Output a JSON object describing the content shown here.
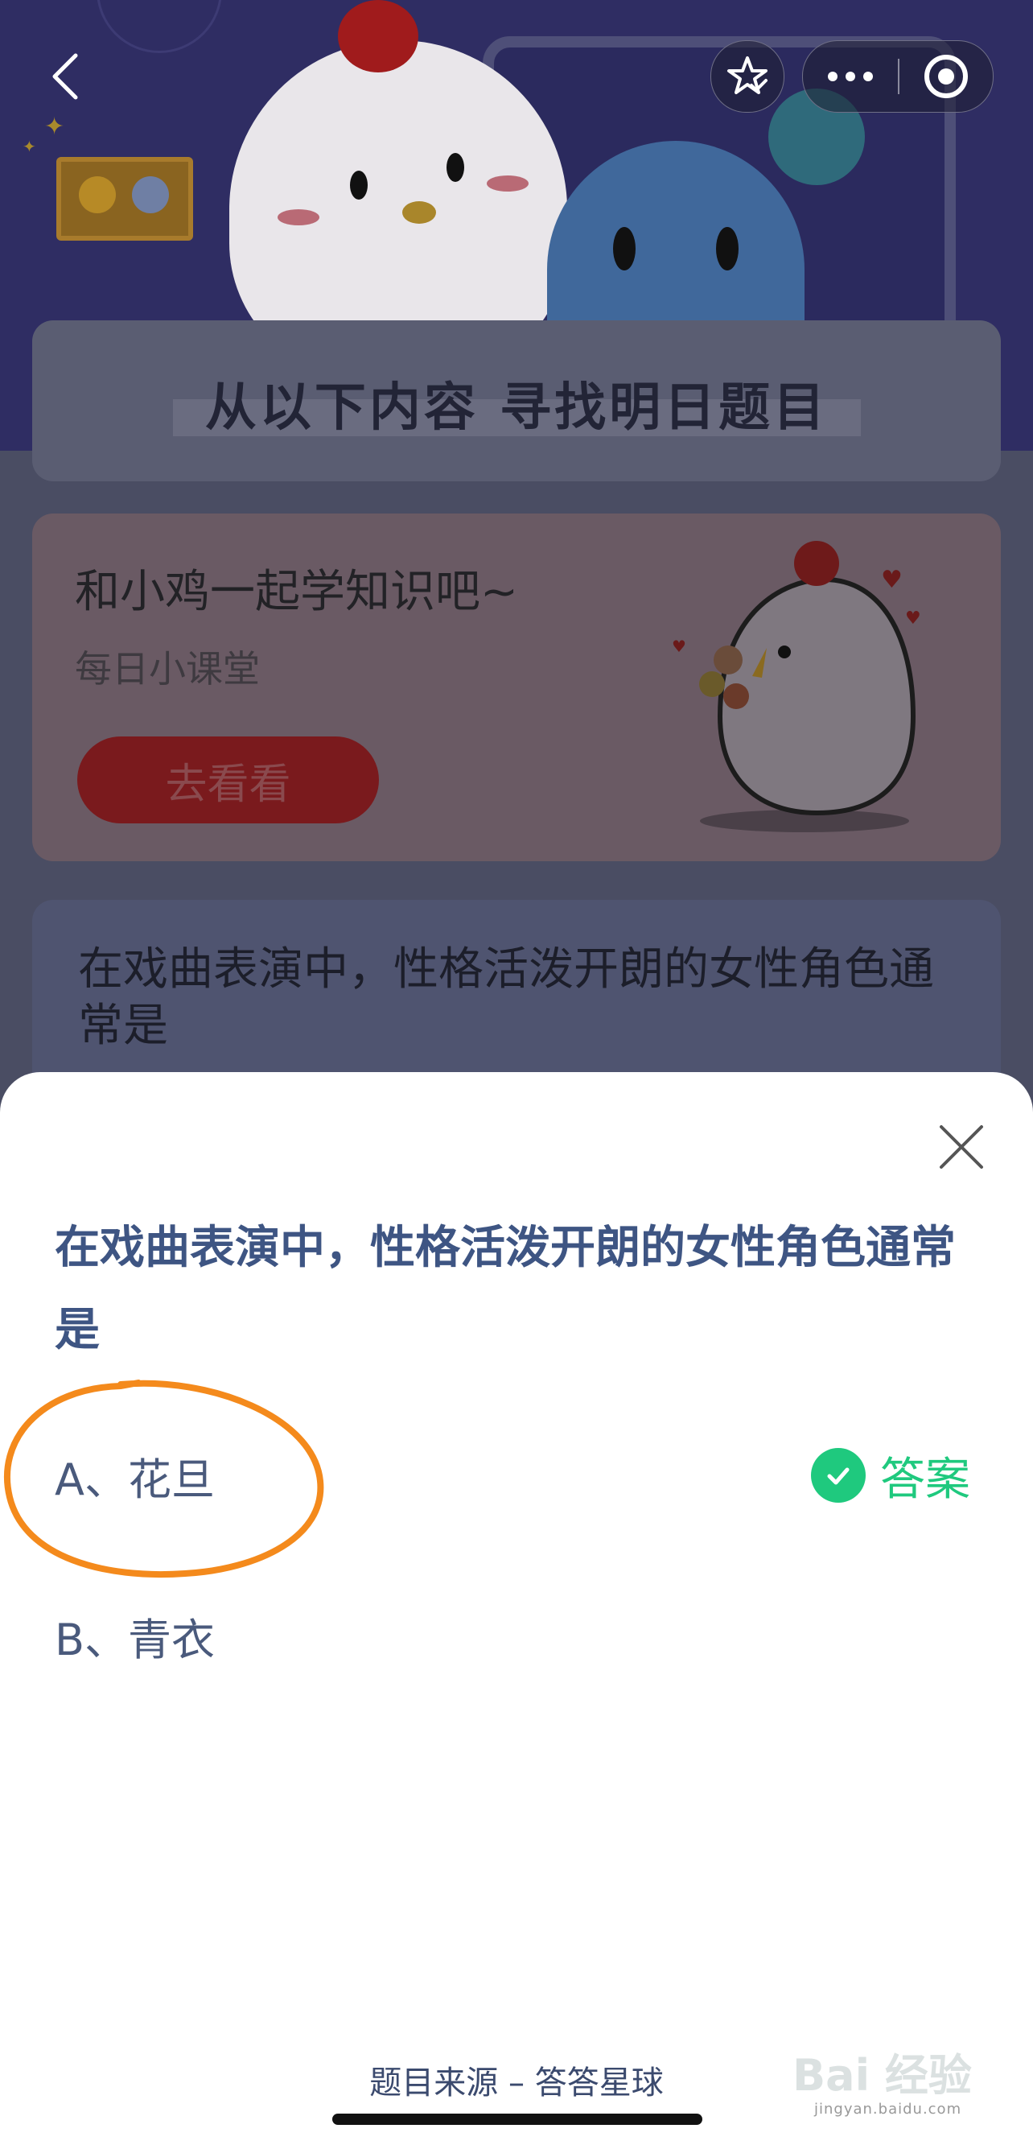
{
  "find_section": {
    "title": "从以下内容  寻找明日题目"
  },
  "learn_card": {
    "title": "和小鸡一起学知识吧~",
    "subtitle": "每日小课堂",
    "button_label": "去看看"
  },
  "question_card": {
    "text": "在戏曲表演中，性格活泼开朗的女性角色通常是"
  },
  "sheet": {
    "question": "在戏曲表演中，性格活泼开朗的女性角色通常是",
    "options": [
      {
        "label": "A、花旦",
        "correct": true
      },
      {
        "label": "B、青衣",
        "correct": false
      }
    ],
    "answer_label": "答案",
    "source": "题目来源 – 答答星球"
  },
  "watermark": {
    "text": "Bai 经验",
    "sub": "jingyan.baidu.com"
  },
  "colors": {
    "question_blue": "#3e5583",
    "answer_green": "#1fc97e",
    "highlight_orange": "#f48a1c",
    "go_button_red": "#7a1a1d"
  },
  "icons": [
    "back-icon",
    "star-check-icon",
    "more-dots-icon",
    "target-icon",
    "close-icon",
    "check-icon"
  ]
}
